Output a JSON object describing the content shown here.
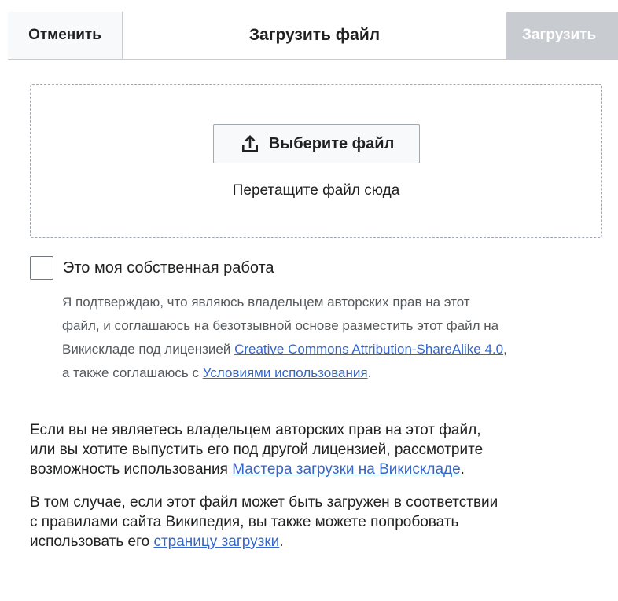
{
  "header": {
    "cancel_label": "Отменить",
    "title": "Загрузить файл",
    "upload_label": "Загрузить"
  },
  "dropzone": {
    "choose_label": "Выберите файл",
    "upload_icon": "upload-icon",
    "hint": "Перетащите файл сюда"
  },
  "own_work": {
    "checked": false,
    "label": "Это моя собственная работа",
    "help_line1": "Я подтверждаю, что являюсь владельцем авторских прав на этот",
    "help_line2": "файл, и соглашаюсь на безотзывной основе разместить этот файл на",
    "help_line3_prefix": "Викискладе под лицензией ",
    "license_link": "Creative Commons Attribution-ShareAlike 4.0",
    "help_line3_suffix": ",",
    "help_line4_prefix": "а также соглашаюсь с ",
    "terms_link": "Условиями использования",
    "help_line4_suffix": "."
  },
  "info": {
    "para1_line1": "Если вы не являетесь владельцем авторских прав на этот файл,",
    "para1_line2": "или вы хотите выпустить его под другой лицензией, рассмотрите",
    "para1_line3_prefix": "возможность использования ",
    "wizard_link": "Мастера загрузки на Викискладе",
    "para1_line3_suffix": ".",
    "para2_line1": "В том случае, если этот файл может быть загружен в соответствии",
    "para2_line2": "с правилами сайта Википедия, вы также можете попробовать",
    "para2_line3_prefix": "использовать его ",
    "upload_page_link": "страницу загрузки",
    "para2_line3_suffix": "."
  },
  "colors": {
    "link": "#3366cc",
    "disabled_button": "#c8ccd1",
    "help_text": "#54595d"
  }
}
